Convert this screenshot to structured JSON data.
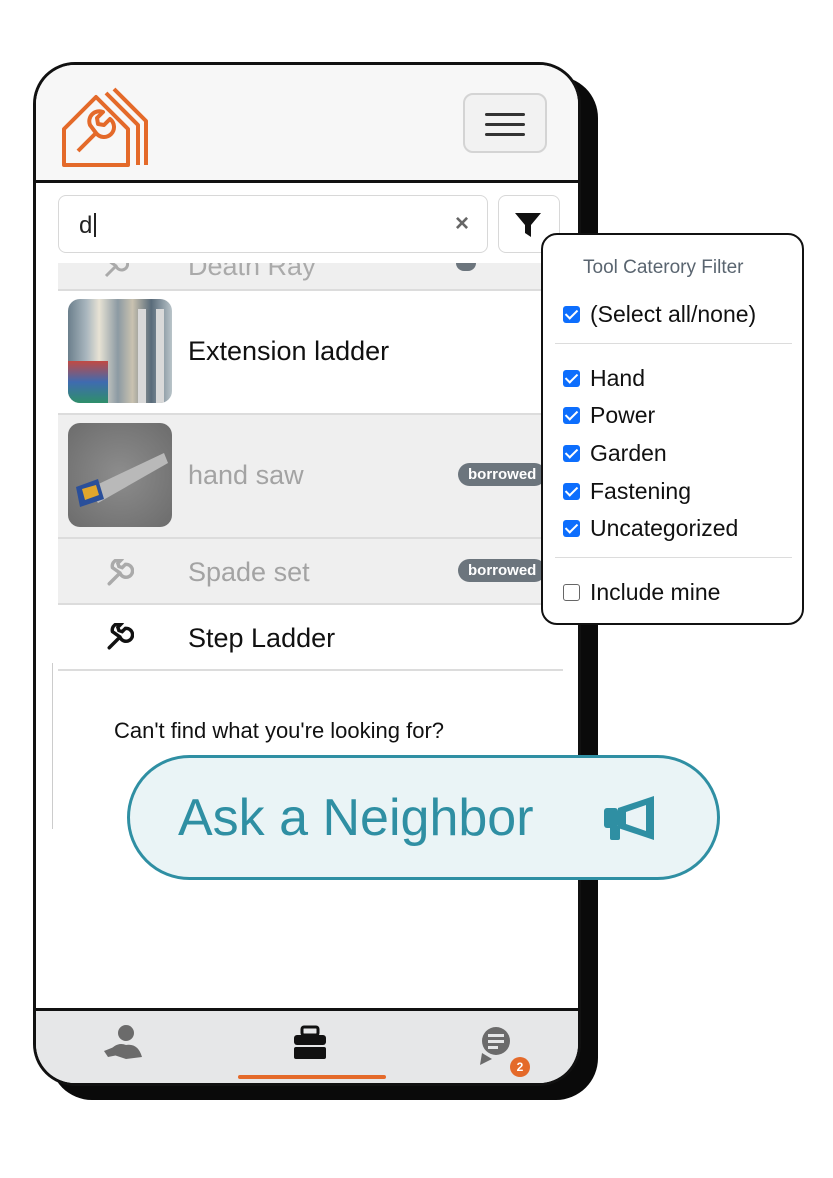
{
  "search": {
    "value": "d"
  },
  "list": {
    "partial_item": {
      "label": "Death Ray"
    },
    "items": [
      {
        "label": "Extension ladder",
        "image": "ladder-photo",
        "badge": "",
        "dimmed": false
      },
      {
        "label": "hand saw",
        "image": "saw-photo",
        "badge": "borrowed",
        "dimmed": true
      },
      {
        "label": "Spade set",
        "image": "wrench-icon",
        "badge": "borrowed",
        "dimmed": true
      },
      {
        "label": "Step Ladder",
        "image": "wrench-icon",
        "badge": "",
        "dimmed": false
      }
    ],
    "help_text": "Can't find what you're looking for?"
  },
  "filter": {
    "title": "Tool Caterory Filter",
    "select_all": {
      "label": "(Select all/none)",
      "checked": true
    },
    "categories": [
      {
        "label": "Hand",
        "checked": true
      },
      {
        "label": "Power",
        "checked": true
      },
      {
        "label": "Garden",
        "checked": true
      },
      {
        "label": "Fastening",
        "checked": true
      },
      {
        "label": "Uncategorized",
        "checked": true
      }
    ],
    "include_mine": {
      "label": "Include mine",
      "checked": false
    }
  },
  "ask": {
    "label": "Ask a Neighbor",
    "icon": "megaphone-icon"
  },
  "bottom_nav": {
    "items": [
      {
        "icon": "neighbors-icon"
      },
      {
        "icon": "toolbox-icon",
        "active": true
      },
      {
        "icon": "messages-icon",
        "badge": "2"
      }
    ]
  },
  "colors": {
    "brand": "#e46a2a",
    "accent": "#2f8fa3",
    "checkbox": "#0d6efd",
    "badge": "#6c757d"
  }
}
